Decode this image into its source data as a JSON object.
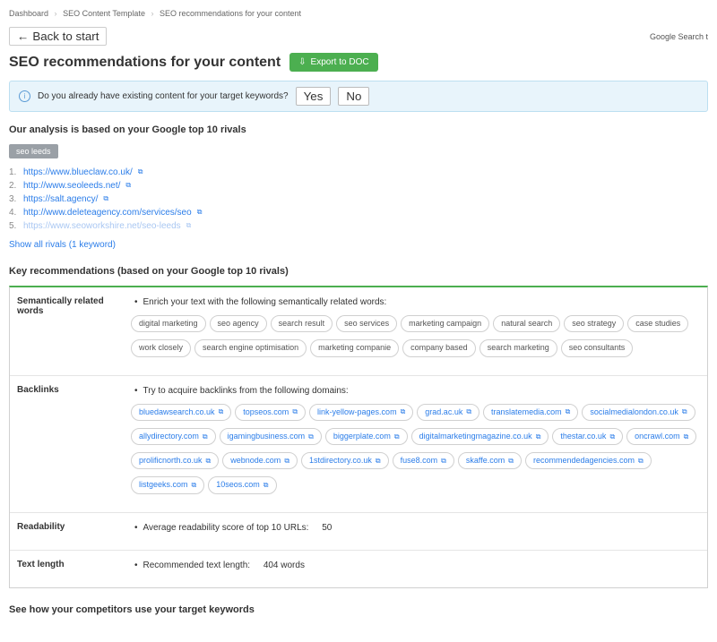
{
  "breadcrumb": {
    "items": [
      "Dashboard",
      "SEO Content Template",
      "SEO recommendations for your content"
    ]
  },
  "back_label": "Back to start",
  "top_right": "Google Search t",
  "page_title": "SEO recommendations for your content",
  "export_label": "Export to DOC",
  "infobar": {
    "question": "Do you already have existing content for your target keywords?",
    "yes": "Yes",
    "no": "No"
  },
  "analysis_heading": "Our analysis is based on your Google top 10 rivals",
  "keyword_tag": "seo leeds",
  "rivals": [
    {
      "n": "1.",
      "url": "https://www.blueclaw.co.uk/"
    },
    {
      "n": "2.",
      "url": "http://www.seoleeds.net/"
    },
    {
      "n": "3.",
      "url": "https://salt.agency/"
    },
    {
      "n": "4.",
      "url": "http://www.deleteagency.com/services/seo"
    },
    {
      "n": "5.",
      "url": "https://www.seoworkshire.net/seo-leeds",
      "faded": true
    }
  ],
  "show_all": {
    "label": "Show all rivals",
    "count": "(1 keyword)"
  },
  "key_rec_heading": "Key recommendations (based on your Google top 10 rivals)",
  "rows": {
    "semantic": {
      "label": "Semantically related words",
      "intro": "Enrich your text with the following semantically related words:",
      "words": [
        "digital marketing",
        "seo agency",
        "search result",
        "seo services",
        "marketing campaign",
        "natural search",
        "seo strategy",
        "case studies",
        "work closely",
        "search engine optimisation",
        "marketing companie",
        "company based",
        "search marketing",
        "seo consultants"
      ]
    },
    "backlinks": {
      "label": "Backlinks",
      "intro": "Try to acquire backlinks from the following domains:",
      "domains": [
        "bluedawsearch.co.uk",
        "topseos.com",
        "link-yellow-pages.com",
        "grad.ac.uk",
        "translatemedia.com",
        "socialmedialondon.co.uk",
        "allydirectory.com",
        "igamingbusiness.com",
        "biggerplate.com",
        "digitalmarketingmagazine.co.uk",
        "thestar.co.uk",
        "oncrawl.com",
        "prolificnorth.co.uk",
        "webnode.com",
        "1stdirectory.co.uk",
        "fuse8.com",
        "skaffe.com",
        "recommendedagencies.com",
        "listgeeks.com",
        "10seos.com"
      ]
    },
    "readability": {
      "label": "Readability",
      "text": "Average readability score of top 10 URLs:",
      "value": "50"
    },
    "textlength": {
      "label": "Text length",
      "text": "Recommended text length:",
      "value": "404 words"
    }
  },
  "competitors_heading": "See how your competitors use your target keywords"
}
